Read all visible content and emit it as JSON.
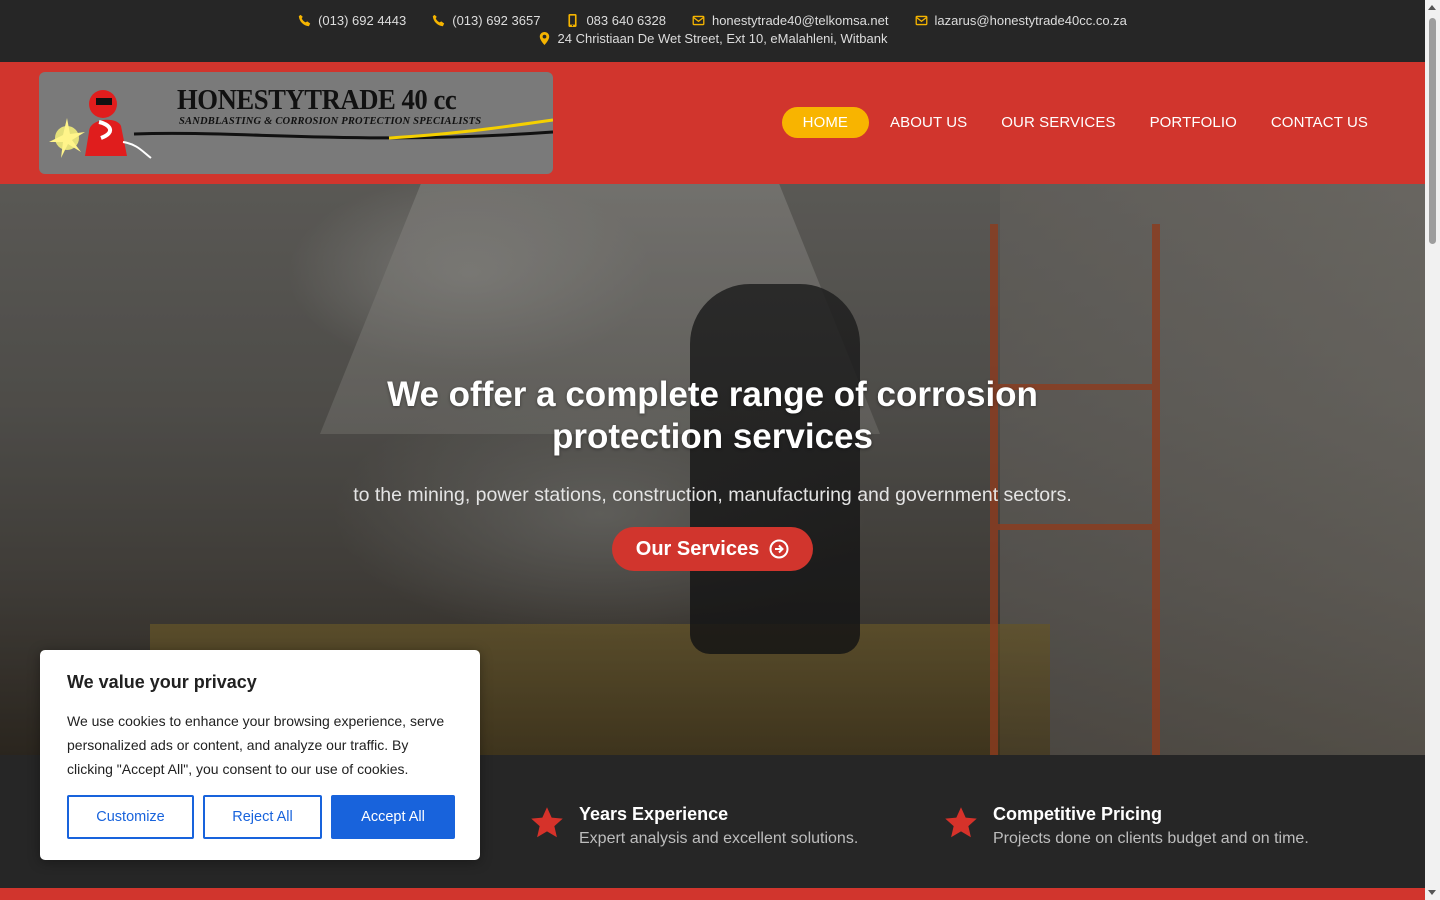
{
  "topbar": {
    "phone1": "(013) 692 4443",
    "phone2": "(013) 692 3657",
    "mobile": "083 640 6328",
    "email1": "honestytrade40@telkomsa.net",
    "email2": "lazarus@honestytrade40cc.co.za",
    "address": "24 Christiaan De Wet Street, Ext 10, eMalahleni, Witbank"
  },
  "logo": {
    "brand": "HONESTYTRADE 40 cc",
    "tagline": "SANDBLASTING & CORROSION PROTECTION SPECIALISTS"
  },
  "nav": {
    "items": [
      {
        "label": "HOME"
      },
      {
        "label": "ABOUT US"
      },
      {
        "label": "OUR SERVICES"
      },
      {
        "label": "PORTFOLIO"
      },
      {
        "label": "CONTACT US"
      }
    ],
    "active_index": 0
  },
  "hero": {
    "title": "We offer a complete range of corrosion protection services",
    "subtitle": "to the mining, power stations, construction, manufacturing and government sectors.",
    "button_label": "Our Services"
  },
  "features": [
    {
      "title": "Years Experience",
      "desc": "Expert analysis and excellent solutions.",
      "icon": "star-icon"
    },
    {
      "title": "Competitive Pricing",
      "desc": "Projects done on clients budget and on time.",
      "icon": "star-icon"
    }
  ],
  "cookie": {
    "title": "We value your privacy",
    "text": "We use cookies to enhance your browsing experience, serve personalized ads or content, and analyze our traffic. By clicking \"Accept All\", you consent to our use of cookies.",
    "customize": "Customize",
    "reject": "Reject All",
    "accept": "Accept All"
  },
  "colors": {
    "brand_red": "#d1352d",
    "accent_yellow": "#f8b400",
    "dark": "#262626",
    "cookie_blue": "#1863dc"
  }
}
